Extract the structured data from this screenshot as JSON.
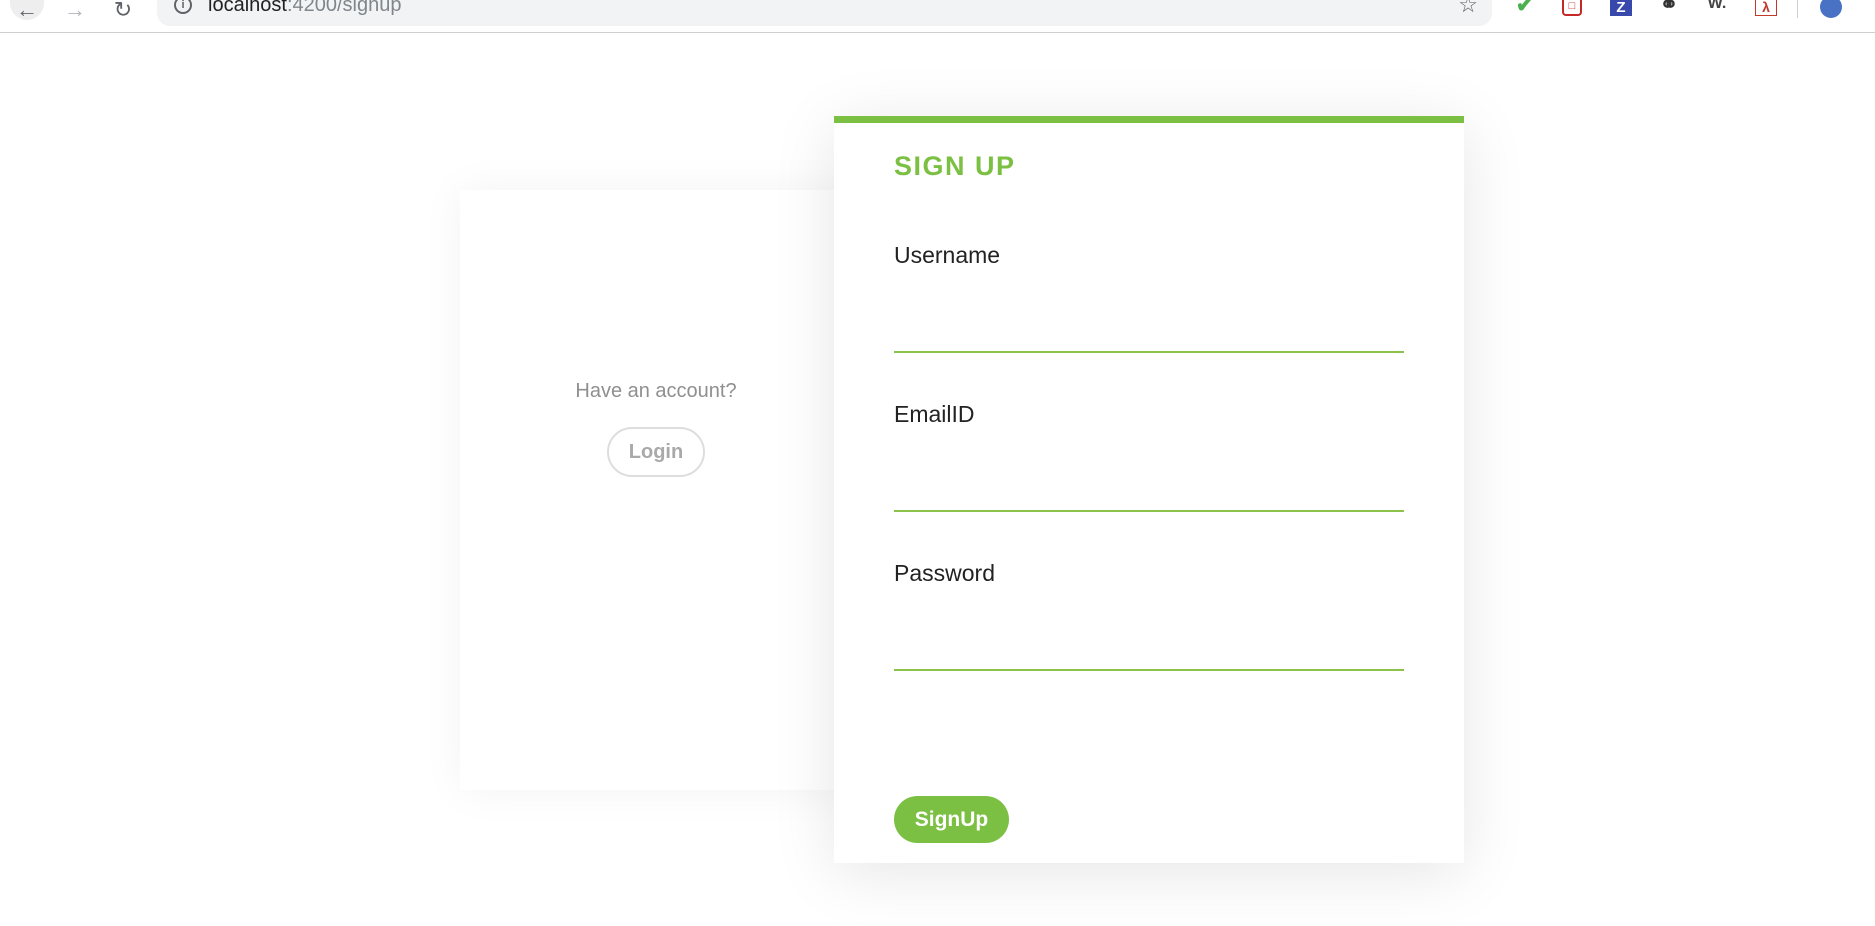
{
  "browser": {
    "url_host": "localhost",
    "url_rest": ":4200/signup",
    "icons": {
      "back": "arrow-left-icon",
      "forward": "arrow-right-icon",
      "reload": "reload-icon",
      "info": "info-icon",
      "bookmark": "star-icon"
    },
    "extensions": [
      "shield-extension",
      "red-extension",
      "z-extension",
      "chain-extension",
      "w-extension",
      "pdf-extension",
      "profile-avatar"
    ]
  },
  "login_panel": {
    "prompt": "Have an account?",
    "login_label": "Login"
  },
  "signup_form": {
    "title": "SIGN UP",
    "username_label": "Username",
    "username_value": "",
    "email_label": "EmailID",
    "email_value": "",
    "password_label": "Password",
    "password_value": "",
    "submit_label": "SignUp"
  },
  "colors": {
    "accent": "#7bc043",
    "input_underline": "#8bc34a",
    "muted_text": "#8f8f8f"
  }
}
